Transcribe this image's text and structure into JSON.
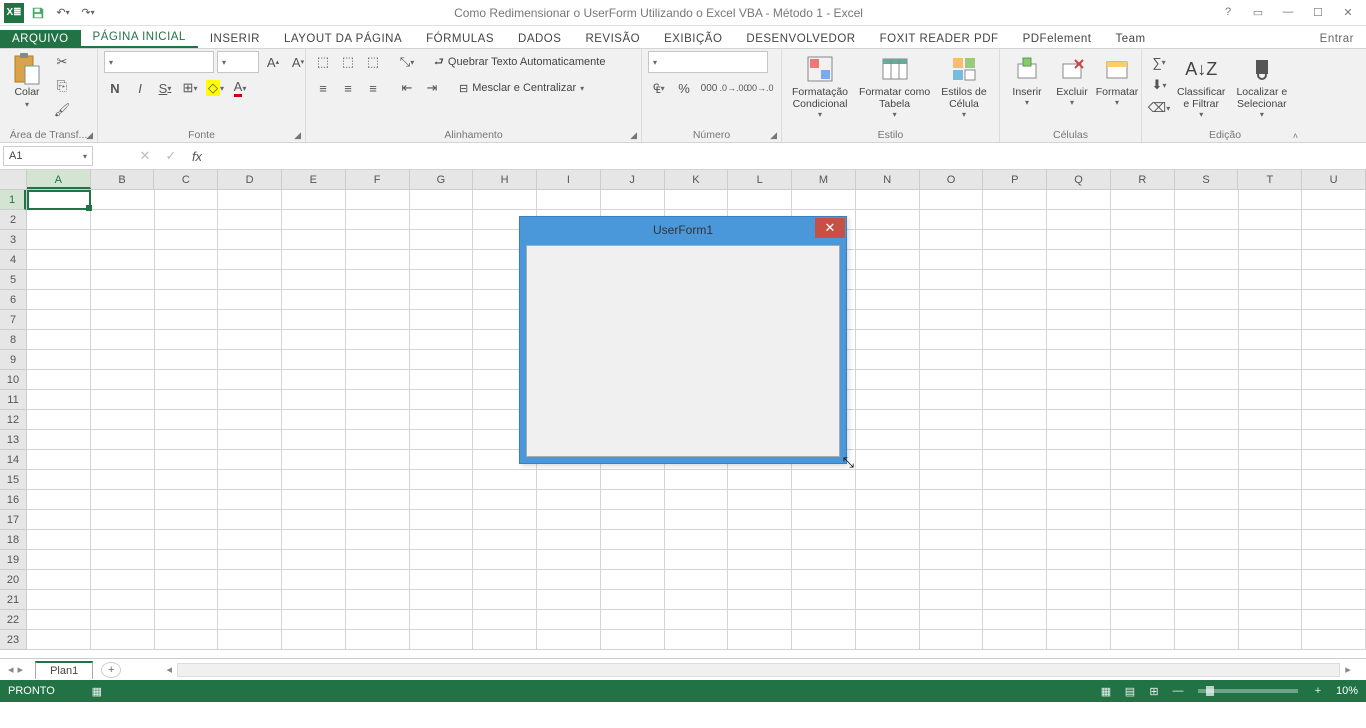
{
  "app": {
    "title": "Como Redimensionar o UserForm Utilizando o Excel VBA - Método 1 - Excel"
  },
  "tabs": {
    "file": "ARQUIVO",
    "items": [
      "PÁGINA INICIAL",
      "INSERIR",
      "LAYOUT DA PÁGINA",
      "FÓRMULAS",
      "DADOS",
      "REVISÃO",
      "EXIBIÇÃO",
      "DESENVOLVEDOR",
      "FOXIT READER PDF",
      "PDFelement",
      "Team"
    ],
    "active_index": 0,
    "right_label": "Entrar"
  },
  "ribbon": {
    "clipboard": {
      "paste": "Colar",
      "group": "Área de Transf..."
    },
    "font": {
      "group": "Fonte",
      "bold": "N",
      "italic": "I",
      "underline": "S"
    },
    "alignment": {
      "wrap": "Quebrar Texto Automaticamente",
      "merge": "Mesclar e Centralizar",
      "group": "Alinhamento"
    },
    "number": {
      "percent": "%",
      "thousands": "000",
      "group": "Número"
    },
    "styles": {
      "conditional": "Formatação\nCondicional",
      "table": "Formatar como\nTabela",
      "cell": "Estilos de\nCélula",
      "group": "Estilo"
    },
    "cells": {
      "insert": "Inserir",
      "delete": "Excluir",
      "format": "Formatar",
      "group": "Células"
    },
    "editing": {
      "sort": "Classificar\ne Filtrar",
      "find": "Localizar e\nSelecionar",
      "group": "Edição"
    }
  },
  "formula_bar": {
    "name_box": "A1"
  },
  "grid": {
    "columns": [
      "A",
      "B",
      "C",
      "D",
      "E",
      "F",
      "G",
      "H",
      "I",
      "J",
      "K",
      "L",
      "M",
      "N",
      "O",
      "P",
      "Q",
      "R",
      "S",
      "T",
      "U"
    ],
    "rows": [
      1,
      2,
      3,
      4,
      5,
      6,
      7,
      8,
      9,
      10,
      11,
      12,
      13,
      14,
      15,
      16,
      17,
      18,
      19,
      20,
      21,
      22,
      23
    ],
    "active_col": 0,
    "active_row": 0
  },
  "userform": {
    "title": "UserForm1"
  },
  "sheets": {
    "active": "Plan1"
  },
  "status": {
    "state": "PRONTO",
    "zoom": "10%"
  }
}
